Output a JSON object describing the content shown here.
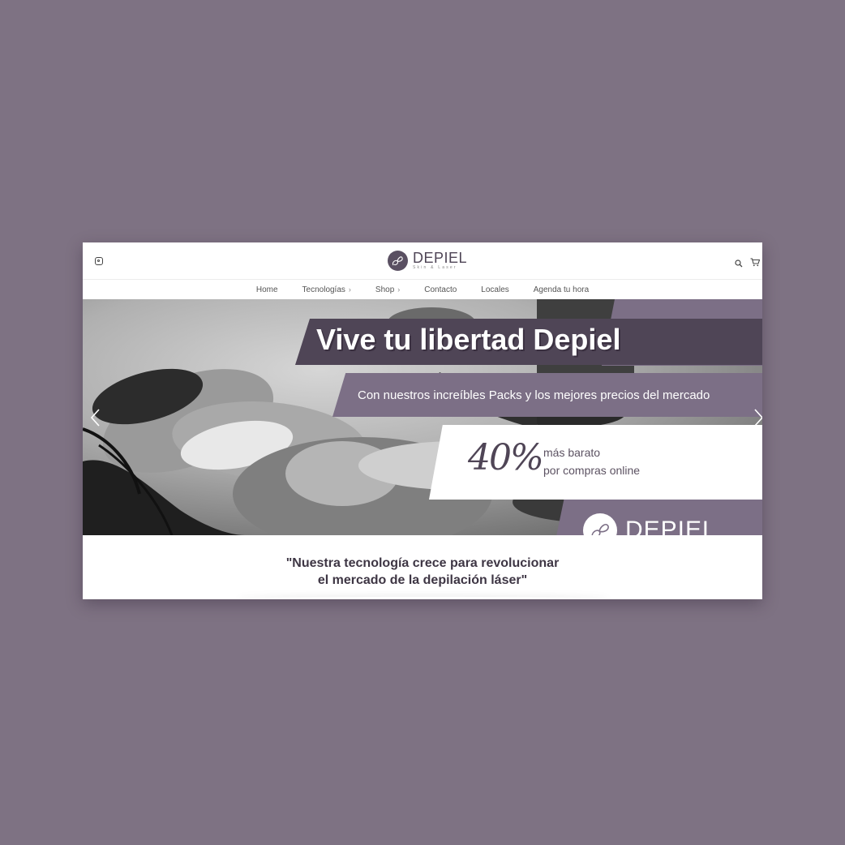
{
  "brand": {
    "name": "DEPIEL",
    "tagline": "Skin & Laser",
    "accent": "#7c6f86",
    "dark": "#4f4556",
    "background": "#7e7283"
  },
  "header": {
    "social_icon": "instagram-icon",
    "search_icon": "search-icon",
    "cart_icon": "cart-icon"
  },
  "nav": {
    "items": [
      {
        "label": "Home",
        "has_submenu": false
      },
      {
        "label": "Tecnologías",
        "has_submenu": true
      },
      {
        "label": "Shop",
        "has_submenu": true
      },
      {
        "label": "Contacto",
        "has_submenu": false
      },
      {
        "label": "Locales",
        "has_submenu": false
      },
      {
        "label": "Agenda tu hora",
        "has_submenu": false
      }
    ],
    "submenu_glyph": "›"
  },
  "hero": {
    "title": "Vive tu libertad Depiel",
    "subtitle": "Con nuestros increíbles Packs y los mejores precios del mercado",
    "discount": "40%",
    "promo_line1": "más barato",
    "promo_line2": "por compras online",
    "logo_text": "DEPIEL"
  },
  "quote": {
    "line1": "\"Nuestra tecnología crece para revolucionar",
    "line2": "el mercado de la depilación láser\""
  }
}
